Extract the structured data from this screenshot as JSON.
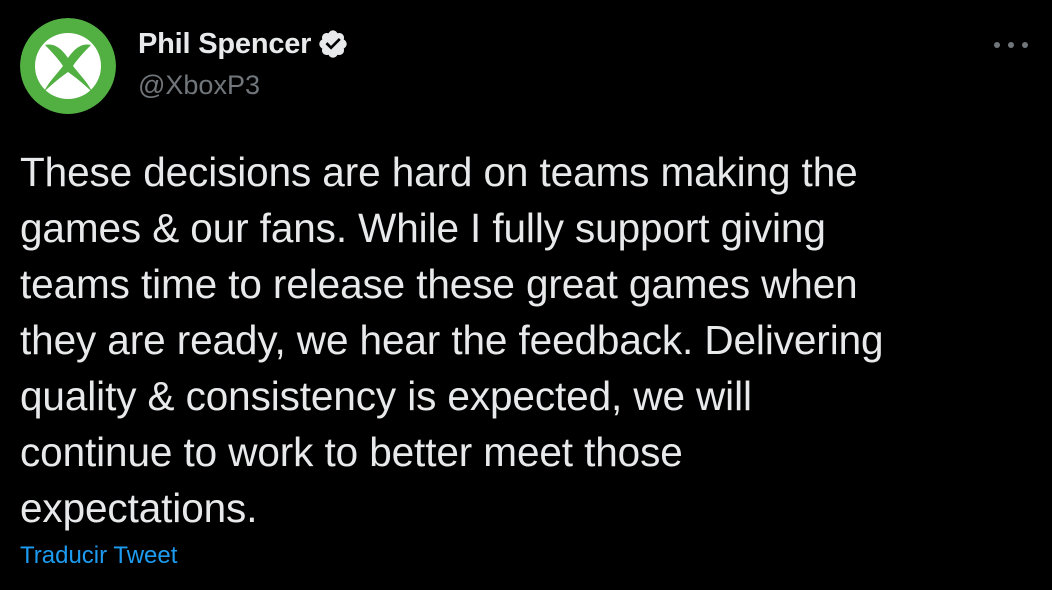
{
  "author": {
    "display_name": "Phil Spencer",
    "handle": "@XboxP3",
    "verified": true,
    "avatar_icon": "xbox-logo-icon"
  },
  "tweet": {
    "text": "These decisions are hard on teams making the\ngames & our fans. While I fully support giving\nteams time to release these great games when\nthey are ready, we hear the feedback. Delivering\nquality & consistency is expected, we will\ncontinue to work to better meet those\nexpectations.",
    "translate_label": "Traducir Tweet"
  },
  "colors": {
    "background": "#000000",
    "text": "#e7e9ea",
    "secondary_text": "#71767b",
    "link": "#1d9bf0",
    "xbox_green": "#52b043"
  }
}
